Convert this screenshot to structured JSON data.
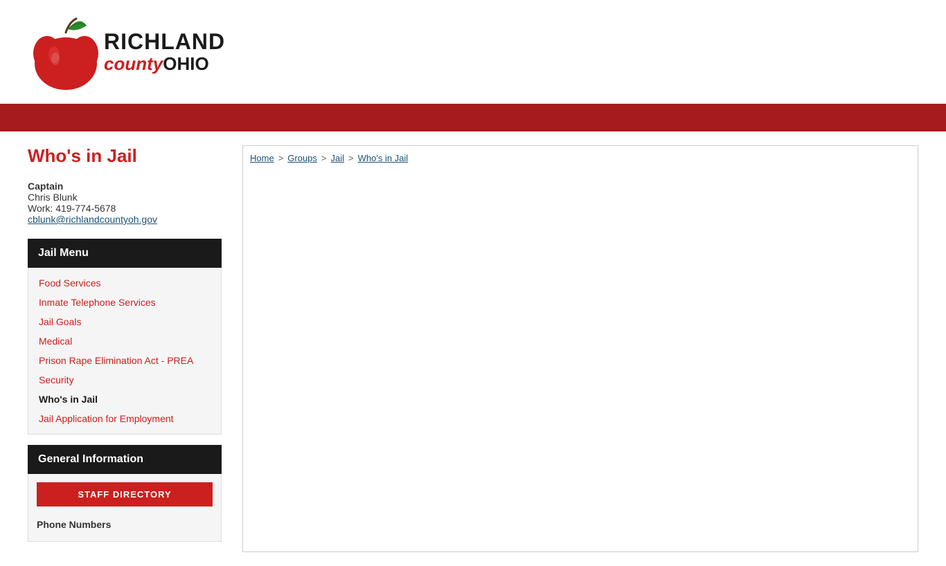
{
  "header": {
    "logo_alt": "Richland County Ohio",
    "logo_richland": "RICHLAND",
    "logo_county": "county",
    "logo_ohio": "OHIO"
  },
  "page": {
    "title": "Who's in Jail"
  },
  "contact": {
    "role": "Captain",
    "name": "Chris Blunk",
    "work_label": "Work: 419-774-5678",
    "email": "cblunk@richlandcountyoh.gov"
  },
  "sidebar": {
    "jail_menu_label": "Jail Menu",
    "items": [
      {
        "label": "Food Services",
        "active": false
      },
      {
        "label": "Inmate Telephone Services",
        "active": false
      },
      {
        "label": "Jail Goals",
        "active": false
      },
      {
        "label": "Medical",
        "active": false
      },
      {
        "label": "Prison Rape Elimination Act - PREA",
        "active": false
      },
      {
        "label": "Security",
        "active": false
      },
      {
        "label": "Who's in Jail",
        "active": true
      },
      {
        "label": "Jail Application for Employment",
        "active": false
      }
    ],
    "general_info_label": "General Information",
    "staff_directory_btn": "STAFF DIRECTORY",
    "phone_numbers_label": "Phone Numbers"
  },
  "breadcrumb": {
    "items": [
      "Home",
      "Groups",
      "Jail",
      "Who's in Jail"
    ]
  }
}
